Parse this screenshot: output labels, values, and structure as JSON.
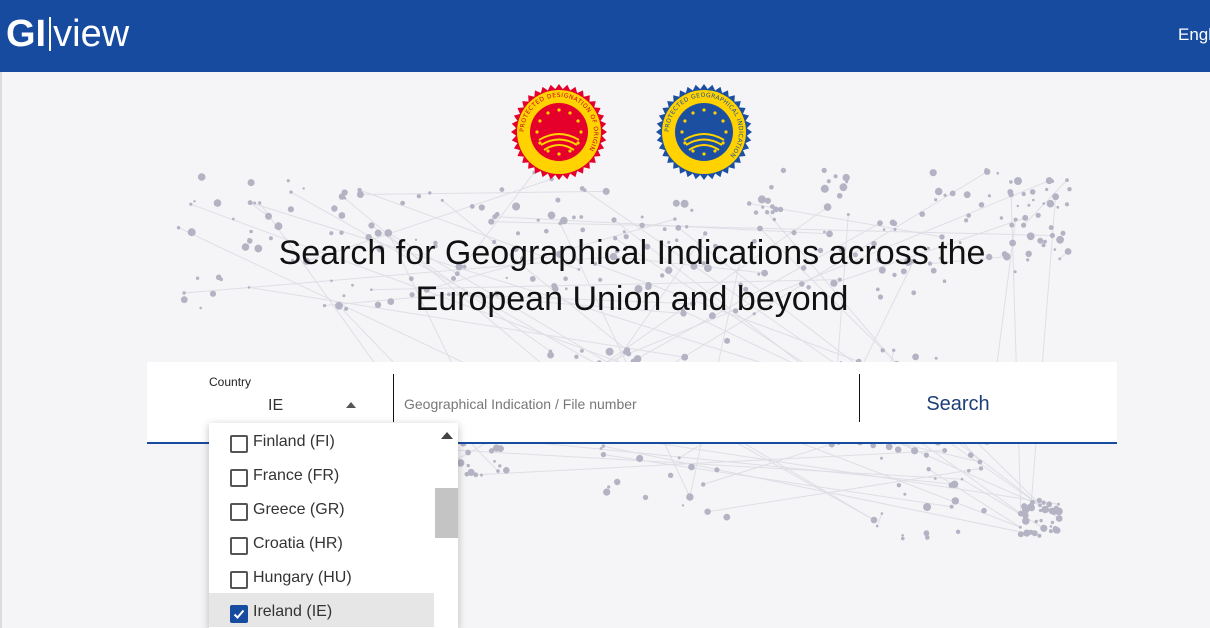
{
  "header": {
    "logo_gi": "GI",
    "logo_view": "view",
    "language": "English"
  },
  "seals": {
    "pdo_text": "PROTECTED DESIGNATION OF ORIGIN",
    "pgi_text": "PROTECTED GEOGRAPHICAL INDICATION"
  },
  "hero": {
    "line1": "Search for Geographical Indications across the",
    "line2": "European Union and beyond"
  },
  "search": {
    "country_label": "Country",
    "country_value": "IE",
    "gi_placeholder": "Geographical Indication / File number",
    "search_label": "Search"
  },
  "country_options": [
    {
      "label": "Finland (FI)",
      "checked": false
    },
    {
      "label": "France (FR)",
      "checked": false
    },
    {
      "label": "Greece (GR)",
      "checked": false
    },
    {
      "label": "Croatia (HR)",
      "checked": false
    },
    {
      "label": "Hungary (HU)",
      "checked": false
    },
    {
      "label": "Ireland (IE)",
      "checked": true
    }
  ],
  "colors": {
    "brand_blue": "#164ba0",
    "pdo_red": "#e4002b",
    "pgi_blue": "#1c4fa0",
    "seal_yellow": "#ffd200"
  }
}
